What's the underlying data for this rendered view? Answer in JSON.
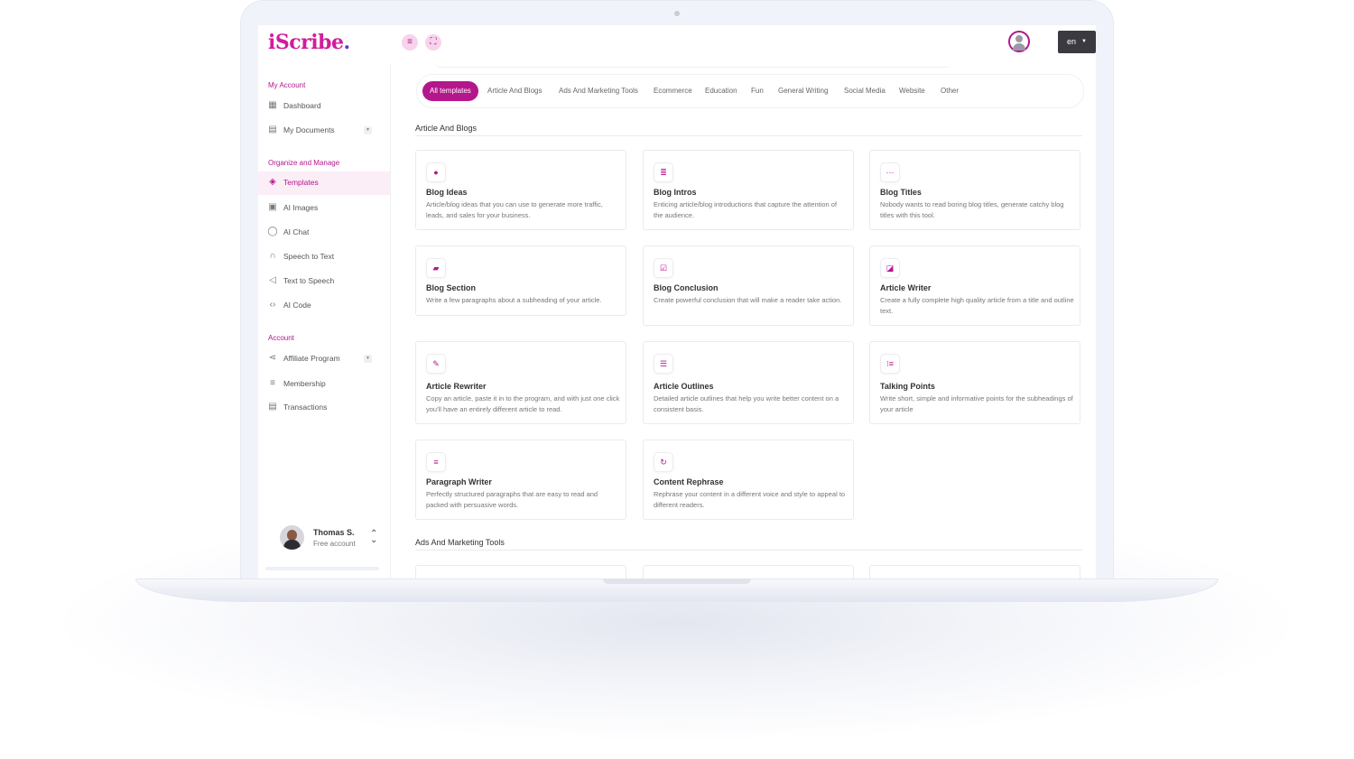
{
  "app": {
    "logo_part1": "iScribe",
    "logo_part2": ".",
    "lang": "en"
  },
  "header": {
    "menu_icon": "menu-icon",
    "fullscreen_icon": "fullscreen-icon"
  },
  "sidebar": {
    "sections": [
      {
        "title": "My Account"
      },
      {
        "title": "Organize and Manage"
      },
      {
        "title": "Account"
      }
    ],
    "items": [
      {
        "label": "Dashboard",
        "icon": "grid-icon"
      },
      {
        "label": "My Documents",
        "icon": "document-icon"
      },
      {
        "label": "Templates",
        "icon": "layers-icon"
      },
      {
        "label": "AI Images",
        "icon": "image-icon"
      },
      {
        "label": "AI Chat",
        "icon": "chat-icon"
      },
      {
        "label": "Speech to Text",
        "icon": "headphones-icon"
      },
      {
        "label": "Text to Speech",
        "icon": "speaker-icon"
      },
      {
        "label": "AI Code",
        "icon": "code-icon"
      },
      {
        "label": "Affiliate Program",
        "icon": "share-icon"
      },
      {
        "label": "Membership",
        "icon": "membership-icon"
      },
      {
        "label": "Transactions",
        "icon": "receipt-icon"
      }
    ],
    "user": {
      "name": "Thomas S.",
      "plan": "Free account"
    }
  },
  "filters": [
    "All templates",
    "Article And Blogs",
    "Ads And Marketing Tools",
    "Ecommerce",
    "Education",
    "Fun",
    "General Writing",
    "Social Media",
    "Website",
    "Other"
  ],
  "groups": [
    {
      "title": "Article And Blogs"
    },
    {
      "title": "Ads And Marketing Tools"
    }
  ],
  "cards": [
    {
      "title": "Blog Ideas",
      "desc": "Article/blog ideas that you can use to generate more traffic, leads, and sales for your business.",
      "icon": "speech-bubble-icon"
    },
    {
      "title": "Blog Intros",
      "desc": "Enticing article/blog introductions that capture the attention of the audience.",
      "icon": "align-left-icon"
    },
    {
      "title": "Blog Titles",
      "desc": "Nobody wants to read boring blog titles, generate catchy blog titles with this tool.",
      "icon": "ellipsis-icon"
    },
    {
      "title": "Blog Section",
      "desc": "Write a few paragraphs about a subheading of your article.",
      "icon": "book-icon"
    },
    {
      "title": "Blog Conclusion",
      "desc": "Create powerful conclusion that will make a reader take action.",
      "icon": "check-square-icon"
    },
    {
      "title": "Article Writer",
      "desc": "Create a fully complete high quality article from a title and outline text.",
      "icon": "pen-square-icon"
    },
    {
      "title": "Article Rewriter",
      "desc": "Copy an article, paste it in to the program, and with just one click you'll have an entirely different article to read.",
      "icon": "edit-icon"
    },
    {
      "title": "Article Outlines",
      "desc": "Detailed article outlines that help you write better content on a consistent basis.",
      "icon": "list-icon"
    },
    {
      "title": "Talking Points",
      "desc": "Write short, simple and informative points for the subheadings of your article",
      "icon": "ordered-list-icon"
    },
    {
      "title": "Paragraph Writer",
      "desc": "Perfectly structured paragraphs that are easy to read and packed with persuasive words.",
      "icon": "paragraph-icon"
    },
    {
      "title": "Content Rephrase",
      "desc": "Rephrase your content in a different voice and style to appeal to different readers.",
      "icon": "refresh-icon"
    }
  ],
  "colors": {
    "accent": "#b4168c",
    "brand_secondary": "#5a3fc8"
  }
}
